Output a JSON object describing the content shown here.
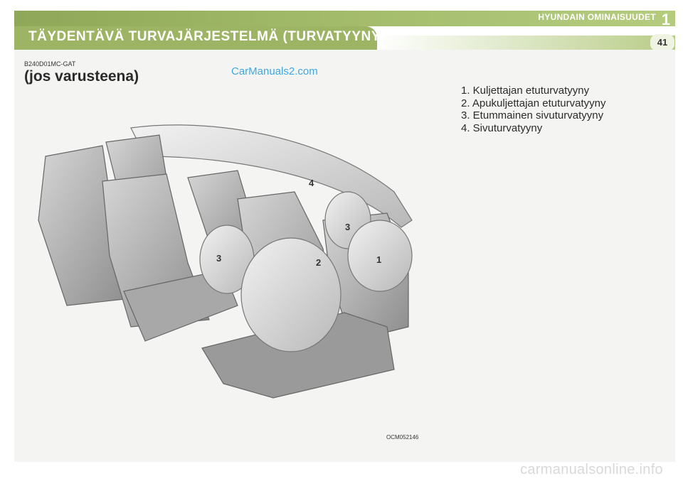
{
  "header": {
    "chapter_title": "HYUNDAIN OMINAISUUDET",
    "chapter_number": "1",
    "section_title": "TÄYDENTÄVÄ TURVAJÄRJESTELMÄ (TURVATYYNY)",
    "page_number": "41"
  },
  "body": {
    "code": "B240D01MC-GAT",
    "subheading": "(jos varusteena)",
    "watermark": "CarManuals2.com"
  },
  "figure": {
    "code": "OCM052146",
    "callouts": [
      "1",
      "2",
      "3",
      "3",
      "4"
    ]
  },
  "legend": {
    "items": [
      "1. Kuljettajan etuturvatyyny",
      "2. Apukuljettajan etuturvatyyny",
      "3. Etummainen sivuturvatyyny",
      "4. Sivuturvatyyny"
    ]
  },
  "footer": {
    "watermark": "carmanualsonline.info"
  }
}
